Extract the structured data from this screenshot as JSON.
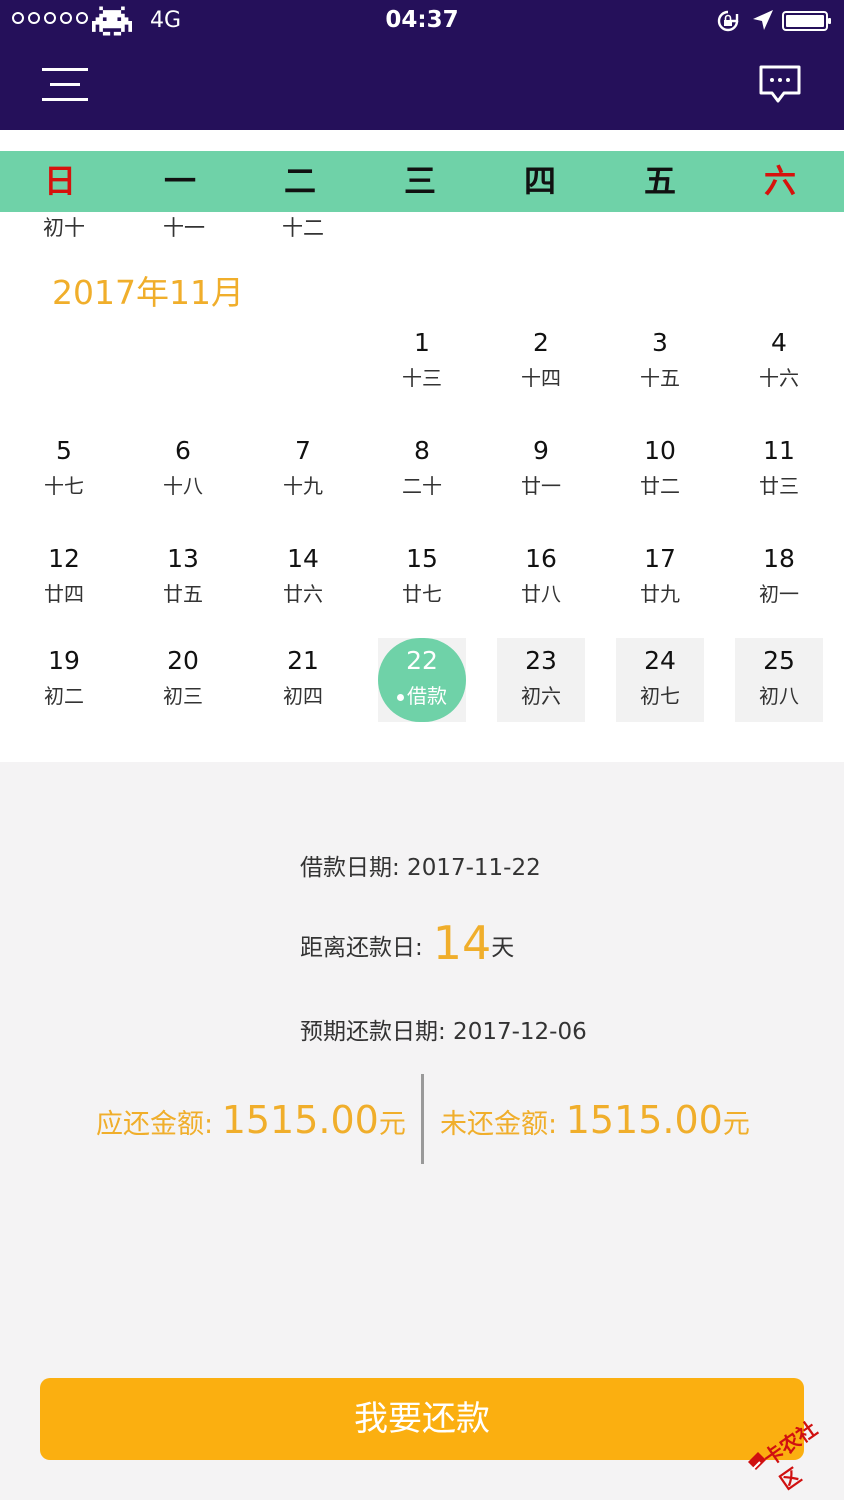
{
  "status_bar": {
    "network": "4G",
    "time": "04:37"
  },
  "weekdays": [
    "日",
    "一",
    "二",
    "三",
    "四",
    "五",
    "六"
  ],
  "prev_month_tail": [
    "初十",
    "十一",
    "十二"
  ],
  "month_title": "2017年11月",
  "days": [
    {
      "num": "1",
      "lunar": "十三"
    },
    {
      "num": "2",
      "lunar": "十四"
    },
    {
      "num": "3",
      "lunar": "十五"
    },
    {
      "num": "4",
      "lunar": "十六"
    },
    {
      "num": "5",
      "lunar": "十七"
    },
    {
      "num": "6",
      "lunar": "十八"
    },
    {
      "num": "7",
      "lunar": "十九"
    },
    {
      "num": "8",
      "lunar": "二十"
    },
    {
      "num": "9",
      "lunar": "廿一"
    },
    {
      "num": "10",
      "lunar": "廿二"
    },
    {
      "num": "11",
      "lunar": "廿三"
    },
    {
      "num": "12",
      "lunar": "廿四"
    },
    {
      "num": "13",
      "lunar": "廿五"
    },
    {
      "num": "14",
      "lunar": "廿六"
    },
    {
      "num": "15",
      "lunar": "廿七"
    },
    {
      "num": "16",
      "lunar": "廿八"
    },
    {
      "num": "17",
      "lunar": "廿九"
    },
    {
      "num": "18",
      "lunar": "初一"
    },
    {
      "num": "19",
      "lunar": "初二"
    },
    {
      "num": "20",
      "lunar": "初三"
    },
    {
      "num": "21",
      "lunar": "初四"
    },
    {
      "num": "22",
      "lunar": "借款"
    },
    {
      "num": "23",
      "lunar": "初六"
    },
    {
      "num": "24",
      "lunar": "初七"
    },
    {
      "num": "25",
      "lunar": "初八"
    }
  ],
  "info": {
    "loan_date": "借款日期: 2017-11-22",
    "countdown_label": "距离还款日:",
    "countdown_value": "14",
    "countdown_unit": "天",
    "due_date": "预期还款日期: 2017-12-06",
    "payable_label": "应还金额:",
    "payable_value": "1515.00",
    "payable_unit": "元",
    "unpaid_label": "未还金额:",
    "unpaid_value": "1515.00",
    "unpaid_unit": "元"
  },
  "repay_button": "我要还款",
  "watermark": "卡农社区",
  "colors": {
    "header": "#25105a",
    "weekbar": "#6fd2a8",
    "accent_gold": "#f0ae2b",
    "button": "#fbaf10",
    "weekend_red": "#d6120c"
  }
}
